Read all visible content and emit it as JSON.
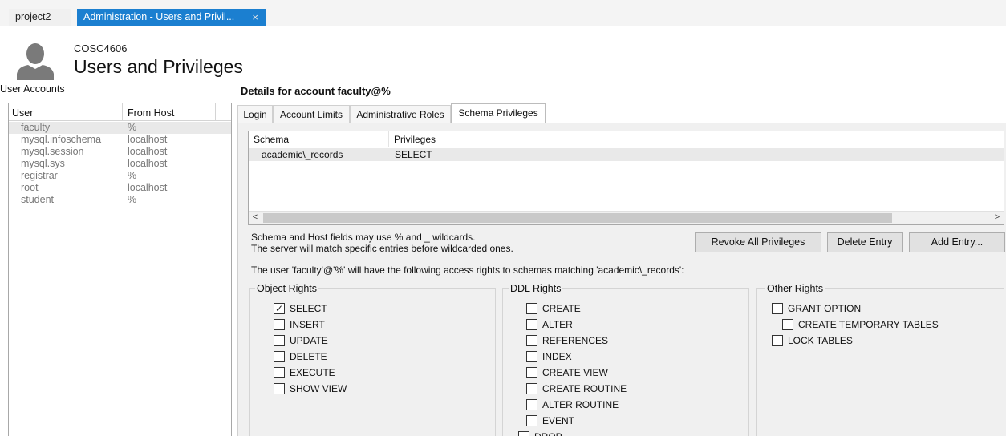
{
  "tabs": {
    "inactive_label": "project2",
    "active_label": "Administration - Users and Privil...",
    "close_glyph": "×"
  },
  "header": {
    "connection_name": "COSC4606",
    "title": "Users and Privileges"
  },
  "user_accounts": {
    "label": "User Accounts",
    "columns": [
      "User",
      "From Host"
    ],
    "rows": [
      {
        "user": "faculty",
        "host": "%",
        "selected": true
      },
      {
        "user": "mysql.infoschema",
        "host": "localhost"
      },
      {
        "user": "mysql.session",
        "host": "localhost"
      },
      {
        "user": "mysql.sys",
        "host": "localhost"
      },
      {
        "user": "registrar",
        "host": "%"
      },
      {
        "user": "root",
        "host": "localhost"
      },
      {
        "user": "student",
        "host": "%"
      }
    ]
  },
  "details": {
    "title": "Details for account faculty@%",
    "tabs": [
      "Login",
      "Account Limits",
      "Administrative Roles",
      "Schema Privileges"
    ],
    "active_tab": "Schema Privileges"
  },
  "schema_grid": {
    "columns": [
      "Schema",
      "Privileges"
    ],
    "rows": [
      {
        "schema": "academic\\_records",
        "privileges": "SELECT"
      }
    ],
    "scroll_left": "<",
    "scroll_right": ">"
  },
  "hint": {
    "line1": "Schema and Host fields may use % and _ wildcards.",
    "line2": "The server will match specific entries before wildcarded ones."
  },
  "buttons": {
    "revoke_all": "Revoke All Privileges",
    "delete_entry": "Delete Entry",
    "add_entry": "Add Entry..."
  },
  "rights_description": "The user 'faculty'@'%' will have the following access rights to schemas matching 'academic\\_records':",
  "object_rights": {
    "label": "Object Rights",
    "items": [
      {
        "label": "SELECT",
        "checked": true
      },
      {
        "label": "INSERT",
        "checked": false
      },
      {
        "label": "UPDATE",
        "checked": false
      },
      {
        "label": "DELETE",
        "checked": false
      },
      {
        "label": "EXECUTE",
        "checked": false
      },
      {
        "label": "SHOW VIEW",
        "checked": false
      }
    ]
  },
  "ddl_rights": {
    "label": "DDL Rights",
    "items": [
      {
        "label": "CREATE",
        "checked": false
      },
      {
        "label": "ALTER",
        "checked": false
      },
      {
        "label": "REFERENCES",
        "checked": false
      },
      {
        "label": "INDEX",
        "checked": false
      },
      {
        "label": "CREATE VIEW",
        "checked": false
      },
      {
        "label": "CREATE ROUTINE",
        "checked": false
      },
      {
        "label": "ALTER ROUTINE",
        "checked": false
      },
      {
        "label": "EVENT",
        "checked": false
      },
      {
        "label": "DROP",
        "checked": false
      }
    ]
  },
  "other_rights": {
    "label": "Other Rights",
    "items": [
      {
        "label": "GRANT OPTION",
        "checked": false
      },
      {
        "label": "CREATE TEMPORARY TABLES",
        "checked": false
      },
      {
        "label": "LOCK TABLES",
        "checked": false
      }
    ]
  },
  "colors": {
    "accent": "#1b7fd0",
    "panel_bg": "#f0f0f0",
    "selected_row": "#e9e9e9"
  }
}
